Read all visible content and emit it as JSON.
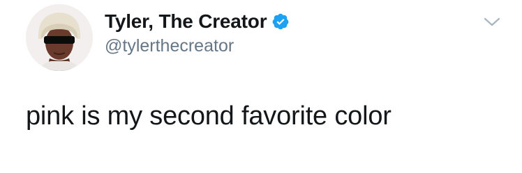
{
  "tweet": {
    "display_name": "Tyler, The Creator",
    "handle": "@tylerthecreator",
    "text": "pink is my second favorite color",
    "verified": true
  },
  "icons": {
    "verified": "verified-badge-icon",
    "menu": "chevron-down-icon"
  },
  "colors": {
    "verified_badge": "#1da1f2",
    "handle": "#657786",
    "caret": "#aab8c2",
    "text": "#14171a"
  }
}
